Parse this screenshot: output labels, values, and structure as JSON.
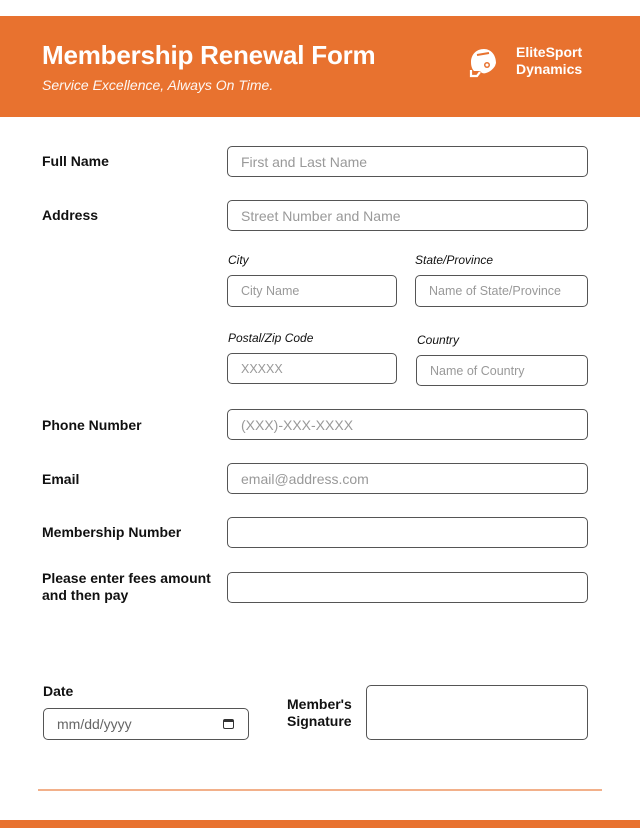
{
  "header": {
    "title": "Membership Renewal Form",
    "subtitle": "Service Excellence, Always On Time.",
    "brand_line1": "EliteSport",
    "brand_line2": "Dynamics",
    "logo_icon": "football-helmet-icon",
    "accent_color": "#e8722f"
  },
  "form": {
    "full_name": {
      "label": "Full Name",
      "placeholder": "First and Last Name"
    },
    "address": {
      "label": "Address",
      "street_placeholder": "Street Number and Name",
      "city": {
        "label": "City",
        "placeholder": "City Name"
      },
      "state": {
        "label": "State/Province",
        "placeholder": "Name of State/Province"
      },
      "postal": {
        "label": "Postal/Zip Code",
        "placeholder": "XXXXX"
      },
      "country": {
        "label": "Country",
        "placeholder": "Name of Country"
      }
    },
    "phone": {
      "label": "Phone Number",
      "placeholder": "(XXX)-XXX-XXXX"
    },
    "email": {
      "label": "Email",
      "placeholder": "email@address.com"
    },
    "membership_number": {
      "label": "Membership Number",
      "placeholder": ""
    },
    "fees": {
      "label_line1": "Please enter fees amount",
      "label_line2": "and then pay",
      "placeholder": ""
    },
    "date": {
      "label": "Date",
      "placeholder": "mm/dd/yyyy"
    },
    "signature": {
      "label_line1": "Member's",
      "label_line2": "Signature"
    }
  }
}
